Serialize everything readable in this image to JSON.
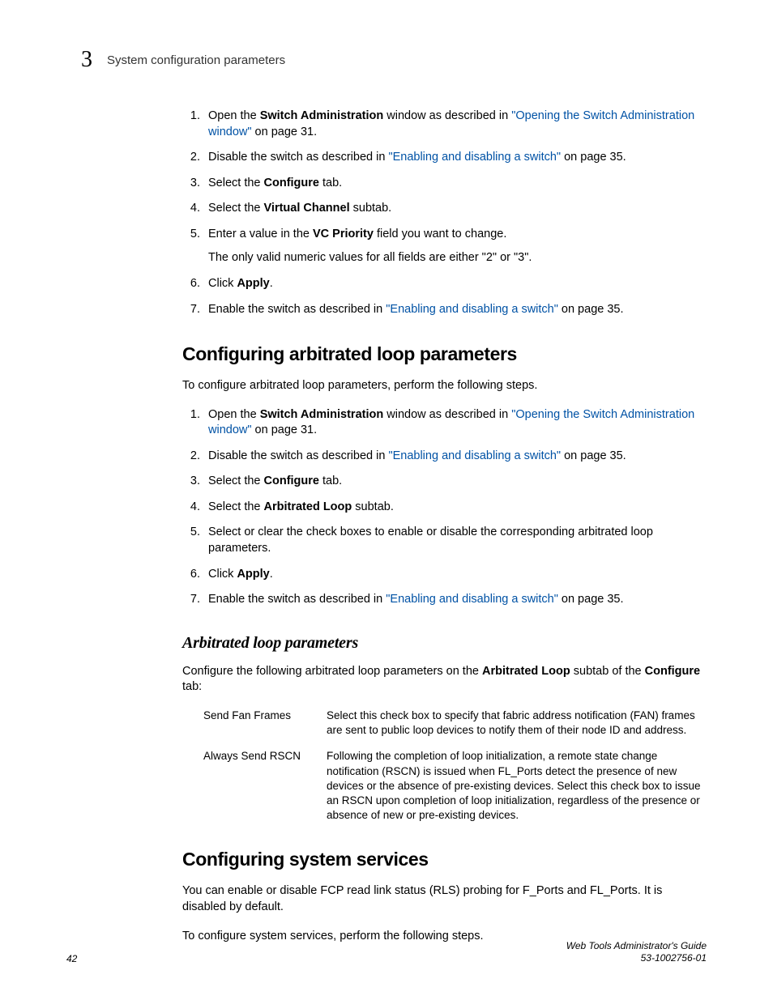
{
  "header": {
    "chapter_number": "3",
    "title": "System configuration parameters"
  },
  "steps_a": {
    "s1": {
      "prefix": "Open the ",
      "bold": "Switch Administration",
      "mid": " window as described in ",
      "link": "\"Opening the Switch Administration window\"",
      "suffix": " on page 31."
    },
    "s2": {
      "prefix": "Disable the switch as described in ",
      "link": "\"Enabling and disabling a switch\"",
      "suffix": " on page 35."
    },
    "s3": {
      "prefix": "Select the ",
      "bold": "Configure",
      "suffix": " tab."
    },
    "s4": {
      "prefix": "Select the ",
      "bold": "Virtual Channel",
      "suffix": " subtab."
    },
    "s5": {
      "prefix": "Enter a value in the ",
      "bold": "VC Priority",
      "suffix": " field you want to change.",
      "sub": "The only valid numeric values for all fields are either \"2\" or \"3\"."
    },
    "s6": {
      "prefix": "Click ",
      "bold": "Apply",
      "suffix": "."
    },
    "s7": {
      "prefix": "Enable the switch as described in ",
      "link": "\"Enabling and disabling a switch\"",
      "suffix": " on page 35."
    }
  },
  "section_b": {
    "title": "Configuring arbitrated loop parameters",
    "intro": "To configure arbitrated loop parameters, perform the following steps."
  },
  "steps_b": {
    "s1": {
      "prefix": "Open the ",
      "bold": "Switch Administration",
      "mid": " window as described in ",
      "link": "\"Opening the Switch Administration window\"",
      "suffix": " on page 31."
    },
    "s2": {
      "prefix": "Disable the switch as described in ",
      "link": "\"Enabling and disabling a switch\"",
      "suffix": " on page 35."
    },
    "s3": {
      "prefix": "Select the ",
      "bold": "Configure",
      "suffix": " tab."
    },
    "s4": {
      "prefix": "Select the ",
      "bold": "Arbitrated Loop",
      "suffix": " subtab."
    },
    "s5": {
      "text": "Select or clear the check boxes to enable or disable the corresponding arbitrated loop parameters."
    },
    "s6": {
      "prefix": "Click ",
      "bold": "Apply",
      "suffix": "."
    },
    "s7": {
      "prefix": "Enable the switch as described in ",
      "link": "\"Enabling and disabling a switch\"",
      "suffix": " on page 35."
    }
  },
  "subsection_b2": {
    "title": "Arbitrated loop parameters",
    "intro_prefix": "Configure the following arbitrated loop parameters on the ",
    "intro_bold1": "Arbitrated Loop",
    "intro_mid": " subtab of the ",
    "intro_bold2": "Configure",
    "intro_suffix": " tab:"
  },
  "params": {
    "p1": {
      "name": "Send Fan Frames",
      "desc": "Select this check box to specify that fabric address notification (FAN) frames are sent to public loop devices to notify them of their node ID and address."
    },
    "p2": {
      "name": "Always Send RSCN",
      "desc": "Following the completion of loop initialization, a remote state change notification (RSCN) is issued when FL_Ports detect the presence of new devices or the absence of pre-existing devices. Select this check box to issue an RSCN upon completion of loop initialization, regardless of the presence or absence of new or pre-existing devices."
    }
  },
  "section_c": {
    "title": "Configuring system services",
    "para1": "You can enable or disable FCP read link status (RLS) probing for F_Ports and FL_Ports. It is disabled by default.",
    "para2": "To configure system services, perform the following steps."
  },
  "footer": {
    "page": "42",
    "doc_title": "Web Tools Administrator's Guide",
    "doc_num": "53-1002756-01"
  }
}
